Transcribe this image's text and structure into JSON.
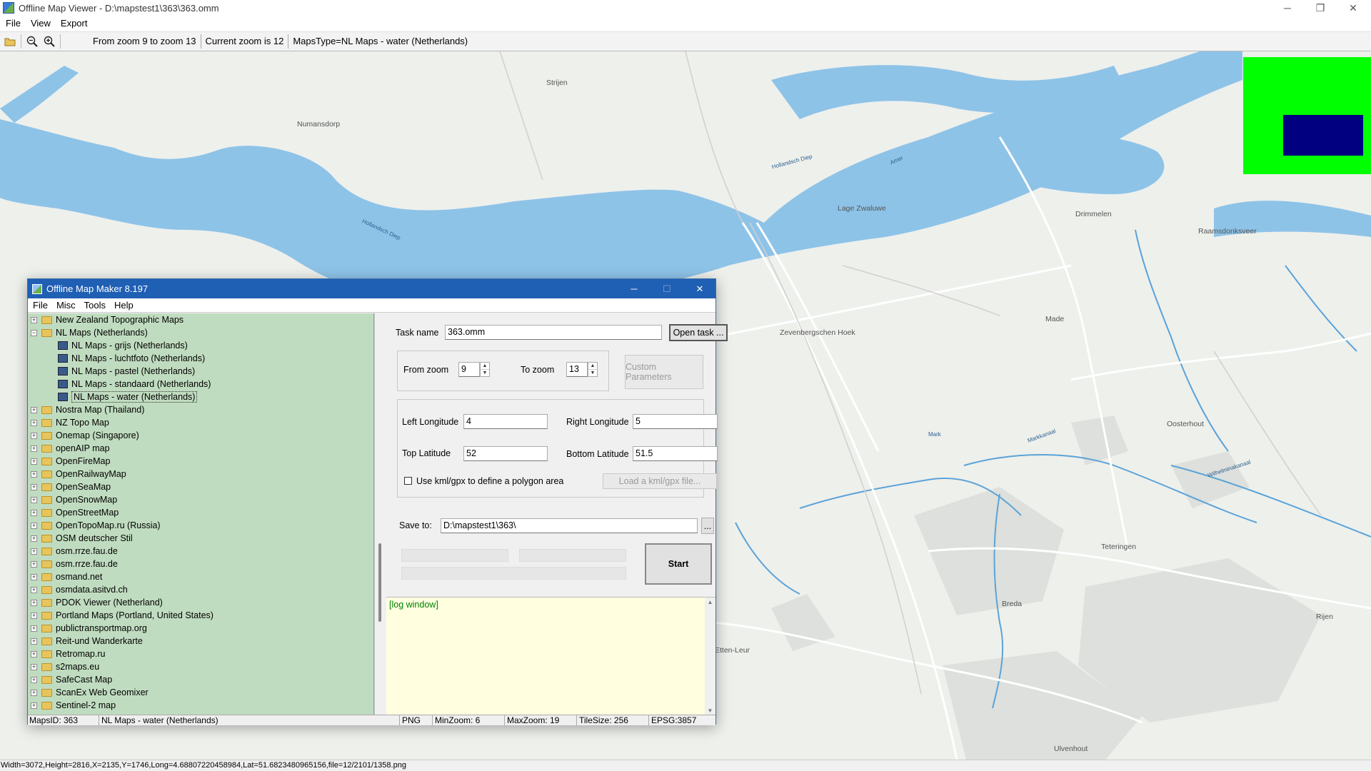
{
  "window": {
    "title": "Offline Map Viewer - D:\\mapstest1\\363\\363.omm",
    "minimize": "─",
    "maximize": "❐",
    "close": "✕"
  },
  "menu": [
    "File",
    "View",
    "Export"
  ],
  "toolbar": {
    "zoom_range": "From zoom 9 to zoom 13",
    "current_zoom": "Current zoom is 12",
    "maps_type": "MapsType=NL Maps - water (Netherlands)"
  },
  "map": {
    "places": [
      "Strijen",
      "Numansdorp",
      "Lage Zwaluwe",
      "Drimmelen",
      "Raamsdonksveer",
      "Zevenbergschen Hoek",
      "Made",
      "Oosterhout",
      "Teteringen",
      "Breda",
      "Rijen",
      "Etten-Leur",
      "Ulvenhout"
    ],
    "water_labels": [
      "Hollandsch Diep",
      "Hollandsch Diep",
      "Amer",
      "Mark",
      "Markkanaal",
      "Wilhelminakanaal"
    ],
    "colors": {
      "land": "#eef0ec",
      "water": "#8ec3e8",
      "river": "#5ba3d9",
      "road": "#ffffff",
      "urban": "#dde0dc"
    }
  },
  "overview": {
    "bg": "#00ff00",
    "viewport": "#000080"
  },
  "status": "Width=3072,Height=2816,X=2135,Y=1746,Long=4.68807220458984,Lat=51.6823480965156,file=12/2101/1358.png",
  "dialog": {
    "title": "Offline Map Maker 8.197",
    "menu": [
      "File",
      "Misc",
      "Tools",
      "Help"
    ],
    "tree": [
      {
        "label": "New Zealand Topographic Maps",
        "type": "folder",
        "exp": "+"
      },
      {
        "label": "NL Maps (Netherlands)",
        "type": "folder",
        "exp": "−"
      },
      {
        "label": "NL Maps - grijs (Netherlands)",
        "type": "map"
      },
      {
        "label": "NL Maps - luchtfoto (Netherlands)",
        "type": "map"
      },
      {
        "label": "NL Maps - pastel (Netherlands)",
        "type": "map"
      },
      {
        "label": "NL Maps - standaard (Netherlands)",
        "type": "map"
      },
      {
        "label": "NL Maps - water (Netherlands)",
        "type": "map",
        "selected": true
      },
      {
        "label": "Nostra Map (Thailand)",
        "type": "folder",
        "exp": "+"
      },
      {
        "label": "NZ Topo Map",
        "type": "folder",
        "exp": "+"
      },
      {
        "label": "Onemap (Singapore)",
        "type": "folder",
        "exp": "+"
      },
      {
        "label": "openAIP map",
        "type": "folder",
        "exp": "+"
      },
      {
        "label": "OpenFireMap",
        "type": "folder",
        "exp": "+"
      },
      {
        "label": "OpenRailwayMap",
        "type": "folder",
        "exp": "+"
      },
      {
        "label": "OpenSeaMap",
        "type": "folder",
        "exp": "+"
      },
      {
        "label": "OpenSnowMap",
        "type": "folder",
        "exp": "+"
      },
      {
        "label": "OpenStreetMap",
        "type": "folder",
        "exp": "+"
      },
      {
        "label": "OpenTopoMap.ru (Russia)",
        "type": "folder",
        "exp": "+"
      },
      {
        "label": "OSM deutscher Stil",
        "type": "folder",
        "exp": "+"
      },
      {
        "label": "osm.rrze.fau.de",
        "type": "folder",
        "exp": "+"
      },
      {
        "label": "osm.rrze.fau.de",
        "type": "folder",
        "exp": "+"
      },
      {
        "label": "osmand.net",
        "type": "folder",
        "exp": "+"
      },
      {
        "label": "osmdata.asitvd.ch",
        "type": "folder",
        "exp": "+"
      },
      {
        "label": "PDOK Viewer (Netherland)",
        "type": "folder",
        "exp": "+"
      },
      {
        "label": "Portland Maps (Portland, United States)",
        "type": "folder",
        "exp": "+"
      },
      {
        "label": "publictransportmap.org",
        "type": "folder",
        "exp": "+"
      },
      {
        "label": "Reit-und Wanderkarte",
        "type": "folder",
        "exp": "+"
      },
      {
        "label": "Retromap.ru",
        "type": "folder",
        "exp": "+"
      },
      {
        "label": "s2maps.eu",
        "type": "folder",
        "exp": "+"
      },
      {
        "label": "SafeCast Map",
        "type": "folder",
        "exp": "+"
      },
      {
        "label": "ScanEx Web Geomixer",
        "type": "folder",
        "exp": "+"
      },
      {
        "label": "Sentinel-2 map",
        "type": "folder",
        "exp": "+"
      }
    ],
    "task_name_label": "Task name",
    "task_name": "363.omm",
    "open_task": "Open task ...",
    "from_zoom_label": "From zoom",
    "from_zoom": "9",
    "to_zoom_label": "To zoom",
    "to_zoom": "13",
    "custom_params": "Custom Parameters",
    "left_lon_label": "Left Longitude",
    "left_lon": "4",
    "right_lon_label": "Right Longitude",
    "right_lon": "5",
    "top_lat_label": "Top Latitude",
    "top_lat": "52",
    "bottom_lat_label": "Bottom Latitude",
    "bottom_lat": "51.5",
    "kml_checkbox": "Use kml/gpx to define a polygon area",
    "load_kml": "Load a kml/gpx file...",
    "save_to_label": "Save to:",
    "save_to": "D:\\mapstest1\\363\\",
    "browse": "...",
    "start": "Start",
    "log": "[log window]",
    "status": {
      "maps_id": "MapsID: 363",
      "map_name": "NL Maps - water (Netherlands)",
      "format": "PNG",
      "min_zoom": "MinZoom: 6",
      "max_zoom": "MaxZoom: 19",
      "tile_size": "TileSize: 256",
      "epsg": "EPSG:3857"
    }
  }
}
